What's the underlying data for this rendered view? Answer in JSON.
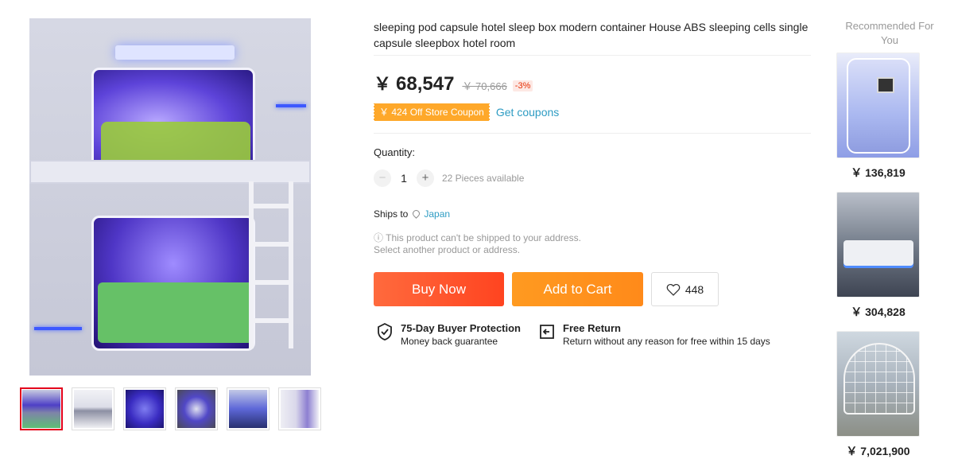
{
  "gallery": {
    "thumbnails": [
      "thumbnail 1",
      "thumbnail 2",
      "thumbnail 3",
      "thumbnail 4",
      "thumbnail 5",
      "thumbnail 6"
    ],
    "active_index": 0
  },
  "product": {
    "title": "sleeping pod capsule hotel sleep box modern container House ABS sleeping cells single capsule sleepbox hotel room",
    "currency": "￥",
    "price": "68,547",
    "original_price": "￥ 70,666",
    "discount": "-3%"
  },
  "coupon": {
    "label": "￥ 424 Off Store Coupon",
    "link": "Get coupons",
    "color": "#fea82a"
  },
  "quantity": {
    "label": "Quantity:",
    "minus": "−",
    "value": "1",
    "plus": "+",
    "available": "22 Pieces available"
  },
  "shipping": {
    "label": "Ships to",
    "country": "Japan",
    "warning_icon": "ⓘ",
    "warning_line1": "This product can't be shipped to your address.",
    "warning_line2": "Select another product or address."
  },
  "actions": {
    "buy_now": "Buy Now",
    "add_to_cart": "Add to Cart",
    "wishlist_count": "448",
    "buy_color": "#ff4420",
    "cart_color": "#ff8a1a"
  },
  "guarantees": [
    {
      "icon": "shield-check-icon",
      "title": "75-Day Buyer Protection",
      "subtitle": "Money back guarantee"
    },
    {
      "icon": "return-arrow-icon",
      "title": "Free Return",
      "subtitle": "Return without any reason for free within 15 days"
    }
  ],
  "recommendations": {
    "title": "Recommended For You",
    "items": [
      {
        "price": "￥ 136,819"
      },
      {
        "price": "￥ 304,828"
      },
      {
        "price": "￥ 7,021,900"
      }
    ]
  }
}
